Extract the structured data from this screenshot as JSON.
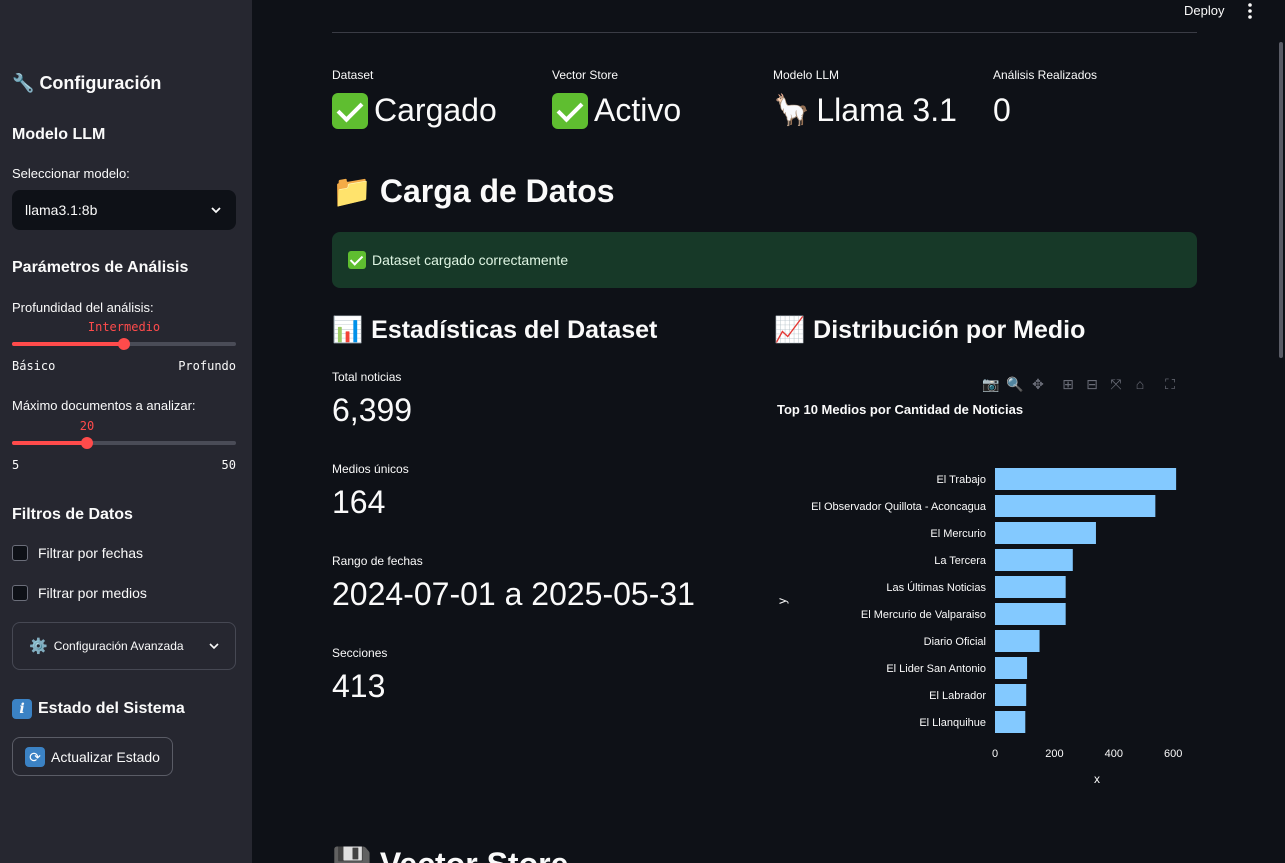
{
  "sidebar": {
    "config_title": "Configuración",
    "model_section": "Modelo LLM",
    "model_label": "Seleccionar modelo:",
    "model_value": "llama3.1:8b",
    "analysis_section": "Parámetros de Análisis",
    "depth_label": "Profundidad del análisis:",
    "depth_value": "Intermedio",
    "depth_min": "Básico",
    "depth_max": "Profundo",
    "depth_fraction": 0.5,
    "docs_label": "Máximo documentos a analizar:",
    "docs_value": "20",
    "docs_min": "5",
    "docs_max": "50",
    "docs_fraction": 0.333,
    "filters_section": "Filtros de Datos",
    "filter_dates": "Filtrar por fechas",
    "filter_media": "Filtrar por medios",
    "advanced_label": "Configuración Avanzada",
    "status_section": "Estado del Sistema",
    "refresh_button": "Actualizar Estado"
  },
  "header": {
    "deploy": "Deploy"
  },
  "metrics": [
    {
      "label": "Dataset",
      "value": "Cargado",
      "icon": "check-icon"
    },
    {
      "label": "Vector Store",
      "value": "Activo",
      "icon": "check-icon"
    },
    {
      "label": "Modelo LLM",
      "value": "Llama 3.1",
      "icon": "llama-icon"
    },
    {
      "label": "Análisis Realizados",
      "value": "0"
    }
  ],
  "load_section": {
    "title": "Carga de Datos",
    "success": "Dataset cargado correctamente"
  },
  "stats_section": {
    "title": "Estadísticas del Dataset",
    "items": [
      {
        "label": "Total noticias",
        "value": "6,399"
      },
      {
        "label": "Medios únicos",
        "value": "164"
      },
      {
        "label": "Rango de fechas",
        "value": "2024-07-01 a 2025-05-31"
      },
      {
        "label": "Secciones",
        "value": "413"
      }
    ]
  },
  "dist_section": {
    "title": "Distribución por Medio"
  },
  "next_section": {
    "title": "Vector Store"
  },
  "colors": {
    "accent": "#ff4b4b",
    "bar": "#83c9ff",
    "success_bg": "#173928"
  },
  "chart_data": {
    "type": "bar",
    "orientation": "horizontal",
    "title": "Top 10 Medios por Cantidad de Noticias",
    "xlabel": "x",
    "ylabel": "y",
    "xlim": [
      0,
      650
    ],
    "xticks": [
      0,
      200,
      400,
      600
    ],
    "categories": [
      "El Trabajo",
      "El Observador Quillota - Aconcagua",
      "El Mercurio",
      "La Tercera",
      "Las Últimas Noticias",
      "El Mercurio de Valparaiso",
      "Diario Oficial",
      "El Lider San Antonio",
      "El Labrador",
      "El Llanquihue"
    ],
    "values": [
      610,
      540,
      340,
      262,
      238,
      238,
      150,
      108,
      105,
      102
    ]
  }
}
